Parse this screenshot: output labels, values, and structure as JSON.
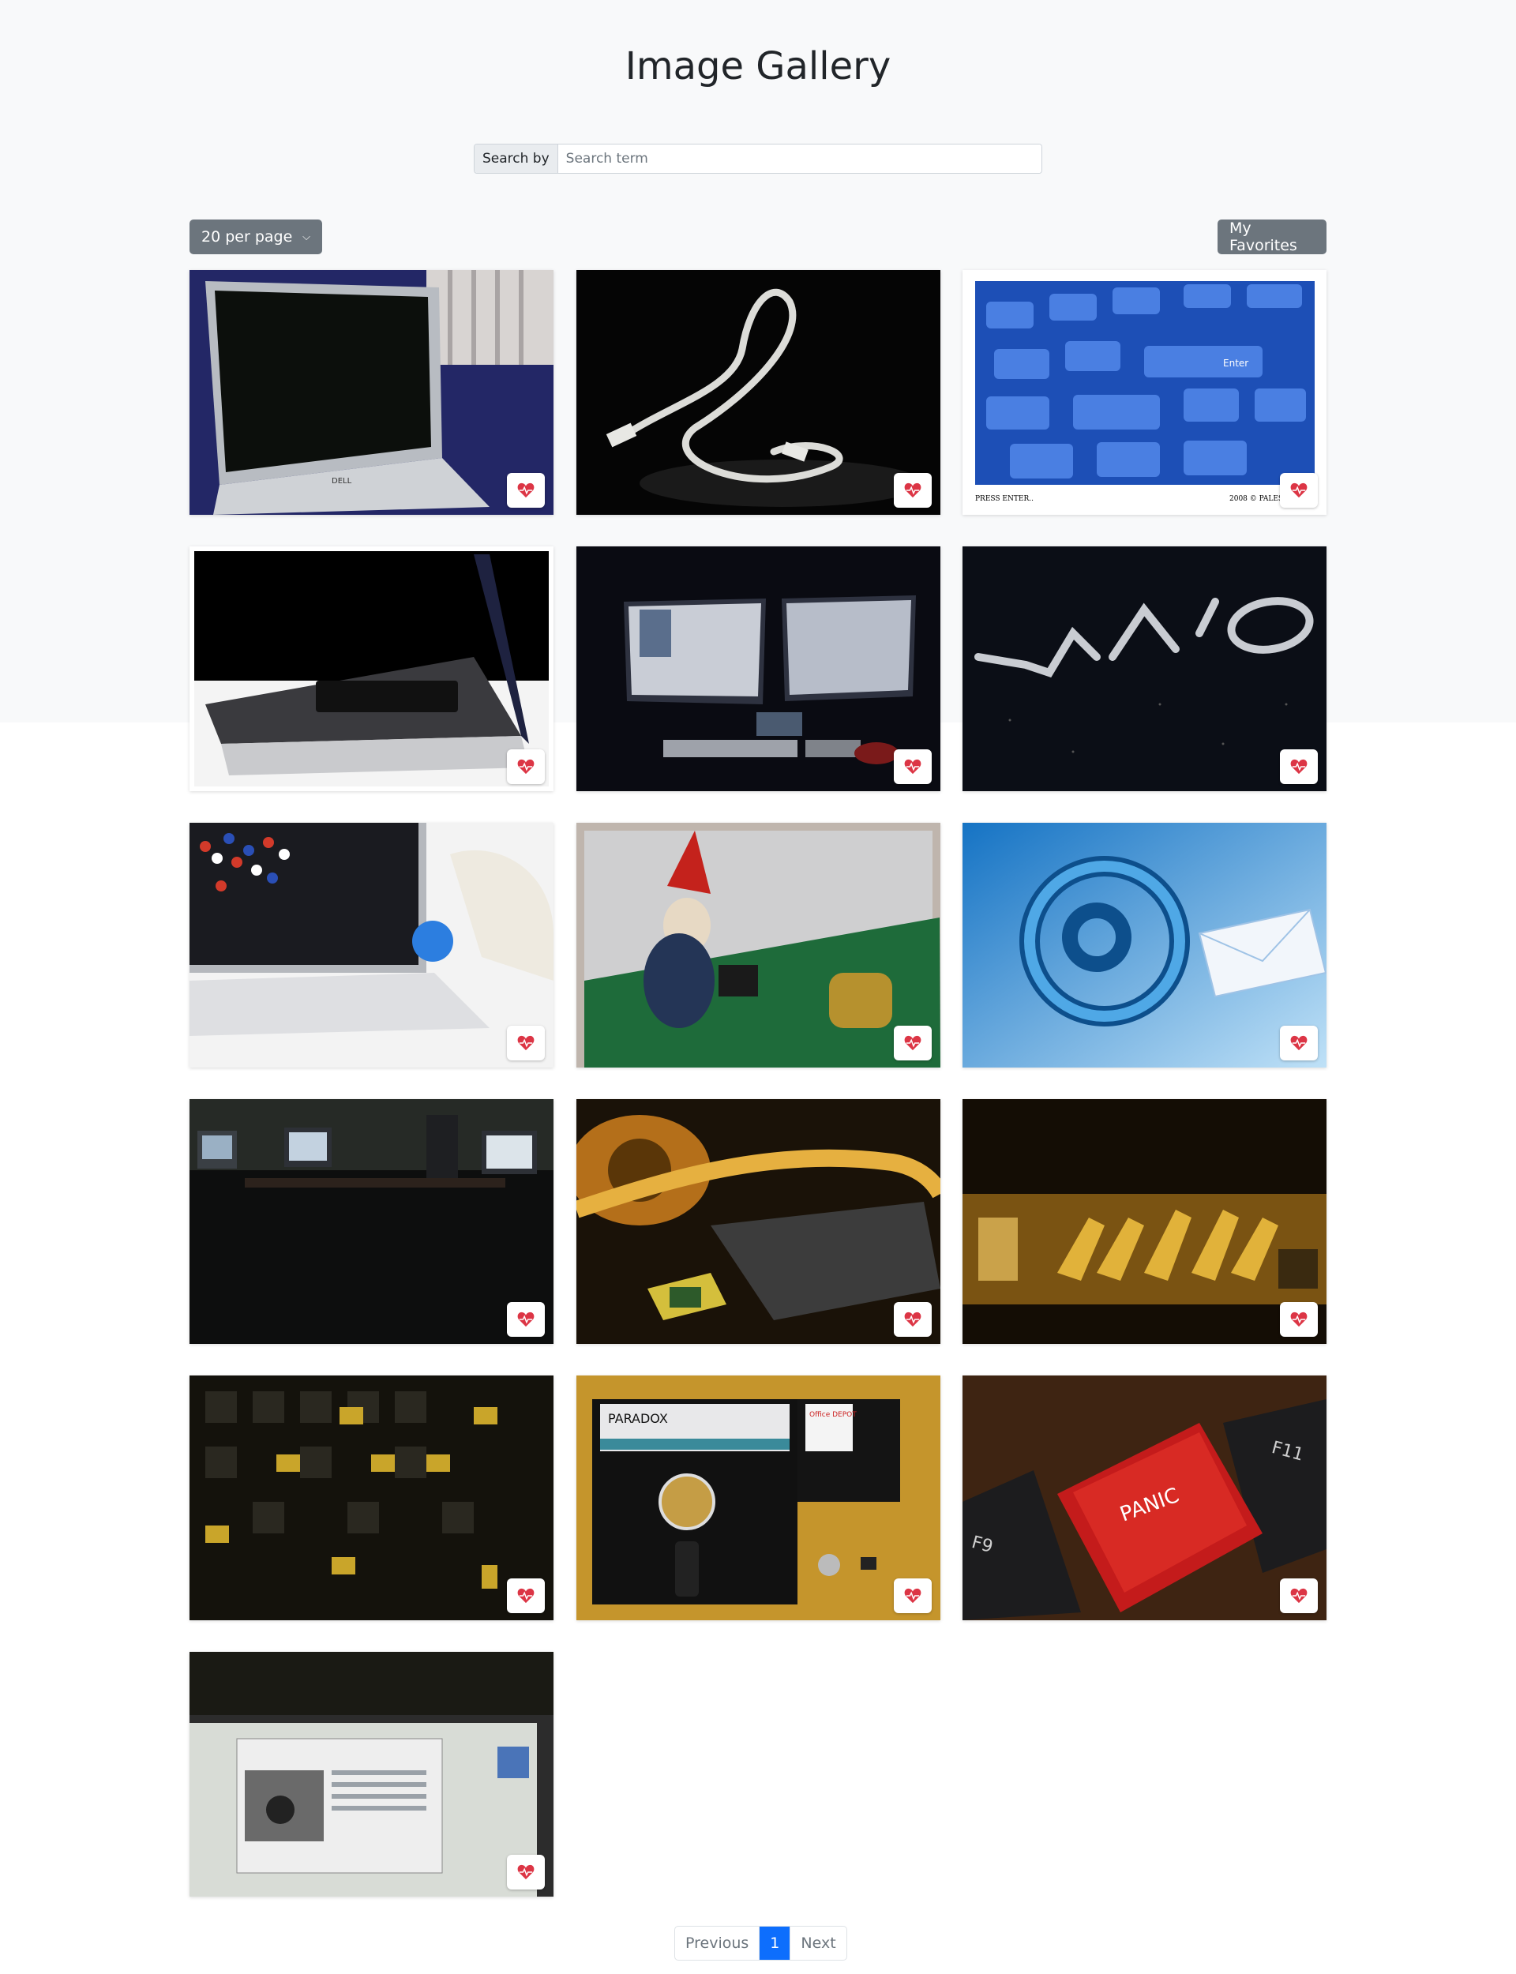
{
  "header": {
    "title": "Image Gallery"
  },
  "search": {
    "label": "Search by",
    "placeholder": "Search term",
    "value": ""
  },
  "toolbar": {
    "per_page_label": "20 per page",
    "favorites_label": "My Favorites"
  },
  "gallery": {
    "items": [
      {
        "subject": "laptop"
      },
      {
        "subject": "network cable"
      },
      {
        "subject": "keyboard",
        "caption_left": "PRESS ENTER..",
        "caption_right": "2008 © PALES"
      },
      {
        "subject": "laptop side view"
      },
      {
        "subject": "dual monitors"
      },
      {
        "subject": "vaio logo"
      },
      {
        "subject": "lab computer"
      },
      {
        "subject": "gnome on circuit board"
      },
      {
        "subject": "email symbol"
      },
      {
        "subject": "dark computer room"
      },
      {
        "subject": "heatsink and cpu"
      },
      {
        "subject": "motherboard components"
      },
      {
        "subject": "memory chips"
      },
      {
        "subject": "floppy disks",
        "text_a": "PARADOX",
        "text_b": "Office DEPOT"
      },
      {
        "subject": "panic key",
        "text_a": "PANIC",
        "text_b": "F11",
        "text_c": "F9"
      },
      {
        "subject": "laptop screen"
      }
    ],
    "favorite_icon": "heart-pulse-icon"
  },
  "pagination": {
    "previous_label": "Previous",
    "current_page": "1",
    "next_label": "Next"
  },
  "colors": {
    "primary": "#0d6efd",
    "secondary": "#6c757d",
    "heart": "#dc3545"
  }
}
